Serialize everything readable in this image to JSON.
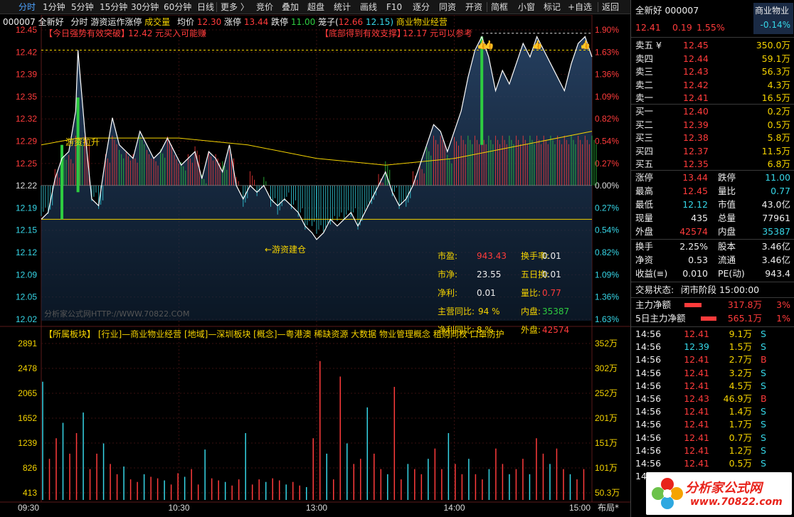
{
  "toolbar": {
    "items": [
      "分时",
      "1分钟",
      "5分钟",
      "15分钟",
      "30分钟",
      "60分钟",
      "日线",
      "更多 〉",
      "竞价",
      "叠加",
      "超盘",
      "统计",
      "画线",
      "F10",
      "逐分",
      "同资",
      "开资",
      "简框",
      "小窗",
      "标记",
      "+自选",
      "返回"
    ],
    "active": "分时"
  },
  "header": {
    "code": "000007",
    "name": "全新好",
    "mode": "分时",
    "indicator": "游资运作涨停",
    "vol_label": "成交量",
    "avg_label": "均价",
    "avg_value": "12.30",
    "limit_up_label": "涨停",
    "limit_up_value": "13.44",
    "limit_down_label": "跌停",
    "limit_down_value": "11.00",
    "cage_label": "笼子(",
    "cage_low": "12.66",
    "cage_high": "12.15)",
    "sector": "商业物业经营"
  },
  "annotations": {
    "breakout": "【今日强势有效突破】",
    "breakout_text": "12.42 元买入可能赚",
    "support": "【底部得到有效支撑】",
    "support_text": "12.17 元可以参考",
    "pull_up": "游资拉升",
    "build": "←游资建仓",
    "watermark1": "分析家公式网HTTP://WWW.70822.COM",
    "tags": "【所属板块】 [行业]—商业物业经营 [地域]—深圳板块 [概念]—粤港澳 稀缺资源 大数据 物业管理概念 租购同权 口罩防护"
  },
  "fundamentals": {
    "pe_label": "市盈:",
    "pe": "943.43",
    "turnover_label": "换手率:",
    "turnover": "0.01",
    "pb_label": "市净:",
    "pb": "23.55",
    "turnover5_label": "五日换:",
    "turnover5": "0.01",
    "profit_label": "净利:",
    "profit": "0.01",
    "vol_ratio_label": "量比:",
    "vol_ratio": "0.77",
    "rev_label": "主营同比:",
    "rev": "94 %",
    "inner_label": "内盘:",
    "inner": "35387",
    "np_label": "净利同比:",
    "np": "8 %",
    "outer_label": "外盘:",
    "outer": "42574"
  },
  "chart_data": {
    "type": "line",
    "price_ticks": [
      "12.45",
      "12.42",
      "12.39",
      "12.35",
      "12.32",
      "12.29",
      "12.25",
      "12.22",
      "12.19",
      "12.15",
      "12.12",
      "12.09",
      "12.05",
      "12.02"
    ],
    "pct_ticks": [
      "1.90%",
      "1.63%",
      "1.36%",
      "1.09%",
      "0.82%",
      "0.54%",
      "0.27%",
      "0.00%",
      "0.27%",
      "0.54%",
      "0.82%",
      "1.09%",
      "1.36%",
      "1.63%"
    ],
    "vol_ticks": [
      "2891",
      "2478",
      "2065",
      "1652",
      "1239",
      "826",
      "413"
    ],
    "vol_ticks_right": [
      "352万",
      "302万",
      "252万",
      "201万",
      "151万",
      "101万",
      "50.3万"
    ],
    "time_ticks": [
      "09:30",
      "10:30",
      "13:00",
      "14:00",
      "15:00"
    ],
    "layout_label": "布局*",
    "ylim": [
      12.02,
      12.45
    ],
    "prev_close": 12.22,
    "price_series": [
      [
        "09:30",
        12.17
      ],
      [
        "09:33",
        12.18
      ],
      [
        "09:36",
        12.23
      ],
      [
        "09:39",
        12.26
      ],
      [
        "09:42",
        12.27
      ],
      [
        "09:45",
        12.33
      ],
      [
        "09:46",
        12.42
      ],
      [
        "09:49",
        12.3
      ],
      [
        "09:52",
        12.2
      ],
      [
        "09:55",
        12.19
      ],
      [
        "09:58",
        12.26
      ],
      [
        "10:01",
        12.32
      ],
      [
        "10:04",
        12.28
      ],
      [
        "10:07",
        12.27
      ],
      [
        "10:10",
        12.26
      ],
      [
        "10:13",
        12.3
      ],
      [
        "10:16",
        12.28
      ],
      [
        "10:19",
        12.26
      ],
      [
        "10:22",
        12.27
      ],
      [
        "10:25",
        12.29
      ],
      [
        "10:28",
        12.27
      ],
      [
        "10:31",
        12.25
      ],
      [
        "10:34",
        12.26
      ],
      [
        "10:37",
        12.27
      ],
      [
        "10:40",
        12.23
      ],
      [
        "10:43",
        12.27
      ],
      [
        "10:46",
        12.26
      ],
      [
        "10:49",
        12.24
      ],
      [
        "10:52",
        12.28
      ],
      [
        "10:55",
        12.22
      ],
      [
        "10:58",
        12.2
      ],
      [
        "11:01",
        12.22
      ],
      [
        "11:04",
        12.21
      ],
      [
        "11:07",
        12.22
      ],
      [
        "11:10",
        12.2
      ],
      [
        "11:13",
        12.19
      ],
      [
        "11:16",
        12.2
      ],
      [
        "11:19",
        12.19
      ],
      [
        "11:22",
        12.18
      ],
      [
        "11:25",
        12.16
      ],
      [
        "11:28",
        12.15
      ],
      [
        "13:00",
        12.14
      ],
      [
        "13:03",
        12.15
      ],
      [
        "13:06",
        12.17
      ],
      [
        "13:09",
        12.16
      ],
      [
        "13:12",
        12.17
      ],
      [
        "13:15",
        12.18
      ],
      [
        "13:18",
        12.16
      ],
      [
        "13:21",
        12.18
      ],
      [
        "13:24",
        12.2
      ],
      [
        "13:27",
        12.22
      ],
      [
        "13:30",
        12.24
      ],
      [
        "13:33",
        12.21
      ],
      [
        "13:36",
        12.19
      ],
      [
        "13:39",
        12.2
      ],
      [
        "13:42",
        12.22
      ],
      [
        "13:45",
        12.25
      ],
      [
        "13:48",
        12.28
      ],
      [
        "13:51",
        12.31
      ],
      [
        "13:54",
        12.3
      ],
      [
        "13:57",
        12.27
      ],
      [
        "14:00",
        12.3
      ],
      [
        "14:03",
        12.33
      ],
      [
        "14:06",
        12.38
      ],
      [
        "14:09",
        12.42
      ],
      [
        "14:12",
        12.44
      ],
      [
        "14:15",
        12.41
      ],
      [
        "14:18",
        12.36
      ],
      [
        "14:21",
        12.39
      ],
      [
        "14:24",
        12.37
      ],
      [
        "14:27",
        12.4
      ],
      [
        "14:30",
        12.43
      ],
      [
        "14:33",
        12.41
      ],
      [
        "14:36",
        12.44
      ],
      [
        "14:39",
        12.42
      ],
      [
        "14:42",
        12.4
      ],
      [
        "14:45",
        12.38
      ],
      [
        "14:48",
        12.36
      ],
      [
        "14:51",
        12.4
      ],
      [
        "14:54",
        12.43
      ],
      [
        "14:57",
        12.44
      ],
      [
        "15:00",
        12.41
      ]
    ],
    "avg_series": [
      [
        "09:30",
        12.28
      ],
      [
        "09:46",
        12.29
      ],
      [
        "10:01",
        12.29
      ],
      [
        "10:30",
        12.29
      ],
      [
        "11:00",
        12.28
      ],
      [
        "11:30",
        12.26
      ],
      [
        "13:00",
        12.26
      ],
      [
        "13:30",
        12.25
      ],
      [
        "14:00",
        12.26
      ],
      [
        "14:30",
        12.28
      ],
      [
        "15:00",
        12.3
      ]
    ],
    "volume_series": [
      2300,
      800,
      1200,
      1500,
      900,
      1300,
      1700,
      600,
      900,
      1100,
      700,
      500,
      650,
      400,
      350,
      500,
      450,
      420,
      380,
      300,
      520,
      450,
      600,
      300,
      980,
      420,
      380,
      350,
      280,
      400,
      1300,
      300,
      400,
      350,
      420,
      380,
      300,
      350,
      280,
      250,
      1200,
      2700,
      900,
      400,
      2400,
      1100,
      700,
      800,
      1800,
      900,
      600,
      500,
      2200,
      400,
      700,
      600,
      500,
      800,
      1000,
      600,
      1300,
      700,
      500,
      800,
      500,
      400,
      600,
      1000,
      700,
      500,
      600,
      800,
      500,
      1200,
      900,
      700,
      1000,
      600,
      500,
      400,
      600
    ]
  },
  "panel": {
    "name": "全新好",
    "code": "000007",
    "sector": "商业物业",
    "price": "12.41",
    "change": "0.19",
    "change_pct": "1.55%",
    "sector_pct": "-0.14%",
    "asks": [
      {
        "label": "卖五 ¥",
        "price": "12.45",
        "vol": "350.0万"
      },
      {
        "label": "卖四",
        "price": "12.44",
        "vol": "59.1万"
      },
      {
        "label": "卖三",
        "price": "12.43",
        "vol": "56.3万"
      },
      {
        "label": "卖二",
        "price": "12.42",
        "vol": "4.3万"
      },
      {
        "label": "卖一",
        "price": "12.41",
        "vol": "16.5万"
      }
    ],
    "bids": [
      {
        "label": "买一",
        "price": "12.40",
        "vol": "0.2万"
      },
      {
        "label": "买二",
        "price": "12.39",
        "vol": "0.5万"
      },
      {
        "label": "买三",
        "price": "12.38",
        "vol": "5.8万"
      },
      {
        "label": "买四",
        "price": "12.37",
        "vol": "11.5万"
      },
      {
        "label": "买五",
        "price": "12.35",
        "vol": "6.8万"
      }
    ],
    "stats": [
      {
        "l1": "涨停",
        "v1": "13.44",
        "l2": "跌停",
        "v2": "11.00"
      },
      {
        "l1": "最高",
        "v1": "12.45",
        "l2": "量比",
        "v2": "0.77"
      },
      {
        "l1": "最低",
        "v1": "12.12",
        "l2": "市值",
        "v2": "43.0亿"
      },
      {
        "l1": "现量",
        "v1": "435",
        "l2": "总量",
        "v2": "77961"
      },
      {
        "l1": "外盘",
        "v1": "42574",
        "l2": "内盘",
        "v2": "35387"
      }
    ],
    "stats2": [
      {
        "l1": "换手",
        "v1": "2.25%",
        "l2": "股本",
        "v2": "3.46亿"
      },
      {
        "l1": "净资",
        "v1": "0.53",
        "l2": "流通",
        "v2": "3.46亿"
      },
      {
        "l1": "收益(≡)",
        "v1": "0.010",
        "l2": "PE(动)",
        "v2": "943.4"
      }
    ],
    "status_label": "交易状态:",
    "status_value": "闭市阶段 15:00:00",
    "flows": [
      {
        "label": "主力净额",
        "value": "317.8万",
        "pct": "3%"
      },
      {
        "label": "5日主力净额",
        "value": "565.1万",
        "pct": "1%"
      }
    ],
    "ticks": [
      {
        "t": "14:56",
        "p": "12.41",
        "v": "9.1万",
        "s": "S"
      },
      {
        "t": "14:56",
        "p": "12.39",
        "v": "1.5万",
        "s": "S"
      },
      {
        "t": "14:56",
        "p": "12.41",
        "v": "2.7万",
        "s": "B"
      },
      {
        "t": "14:56",
        "p": "12.41",
        "v": "3.2万",
        "s": "S"
      },
      {
        "t": "14:56",
        "p": "12.41",
        "v": "4.5万",
        "s": "S"
      },
      {
        "t": "14:56",
        "p": "12.43",
        "v": "46.9万",
        "s": "B"
      },
      {
        "t": "14:56",
        "p": "12.41",
        "v": "1.4万",
        "s": "S"
      },
      {
        "t": "14:56",
        "p": "12.41",
        "v": "1.7万",
        "s": "S"
      },
      {
        "t": "14:56",
        "p": "12.41",
        "v": "0.7万",
        "s": "S"
      },
      {
        "t": "14:56",
        "p": "12.41",
        "v": "1.2万",
        "s": "S"
      },
      {
        "t": "14:56",
        "p": "12.41",
        "v": "0.5万",
        "s": "S"
      },
      {
        "t": "14:56",
        "p": "12.41",
        "v": "0.1万",
        "s": "B"
      }
    ],
    "logo_text1": "分析家公式网",
    "logo_text2": "www.70822.com"
  }
}
